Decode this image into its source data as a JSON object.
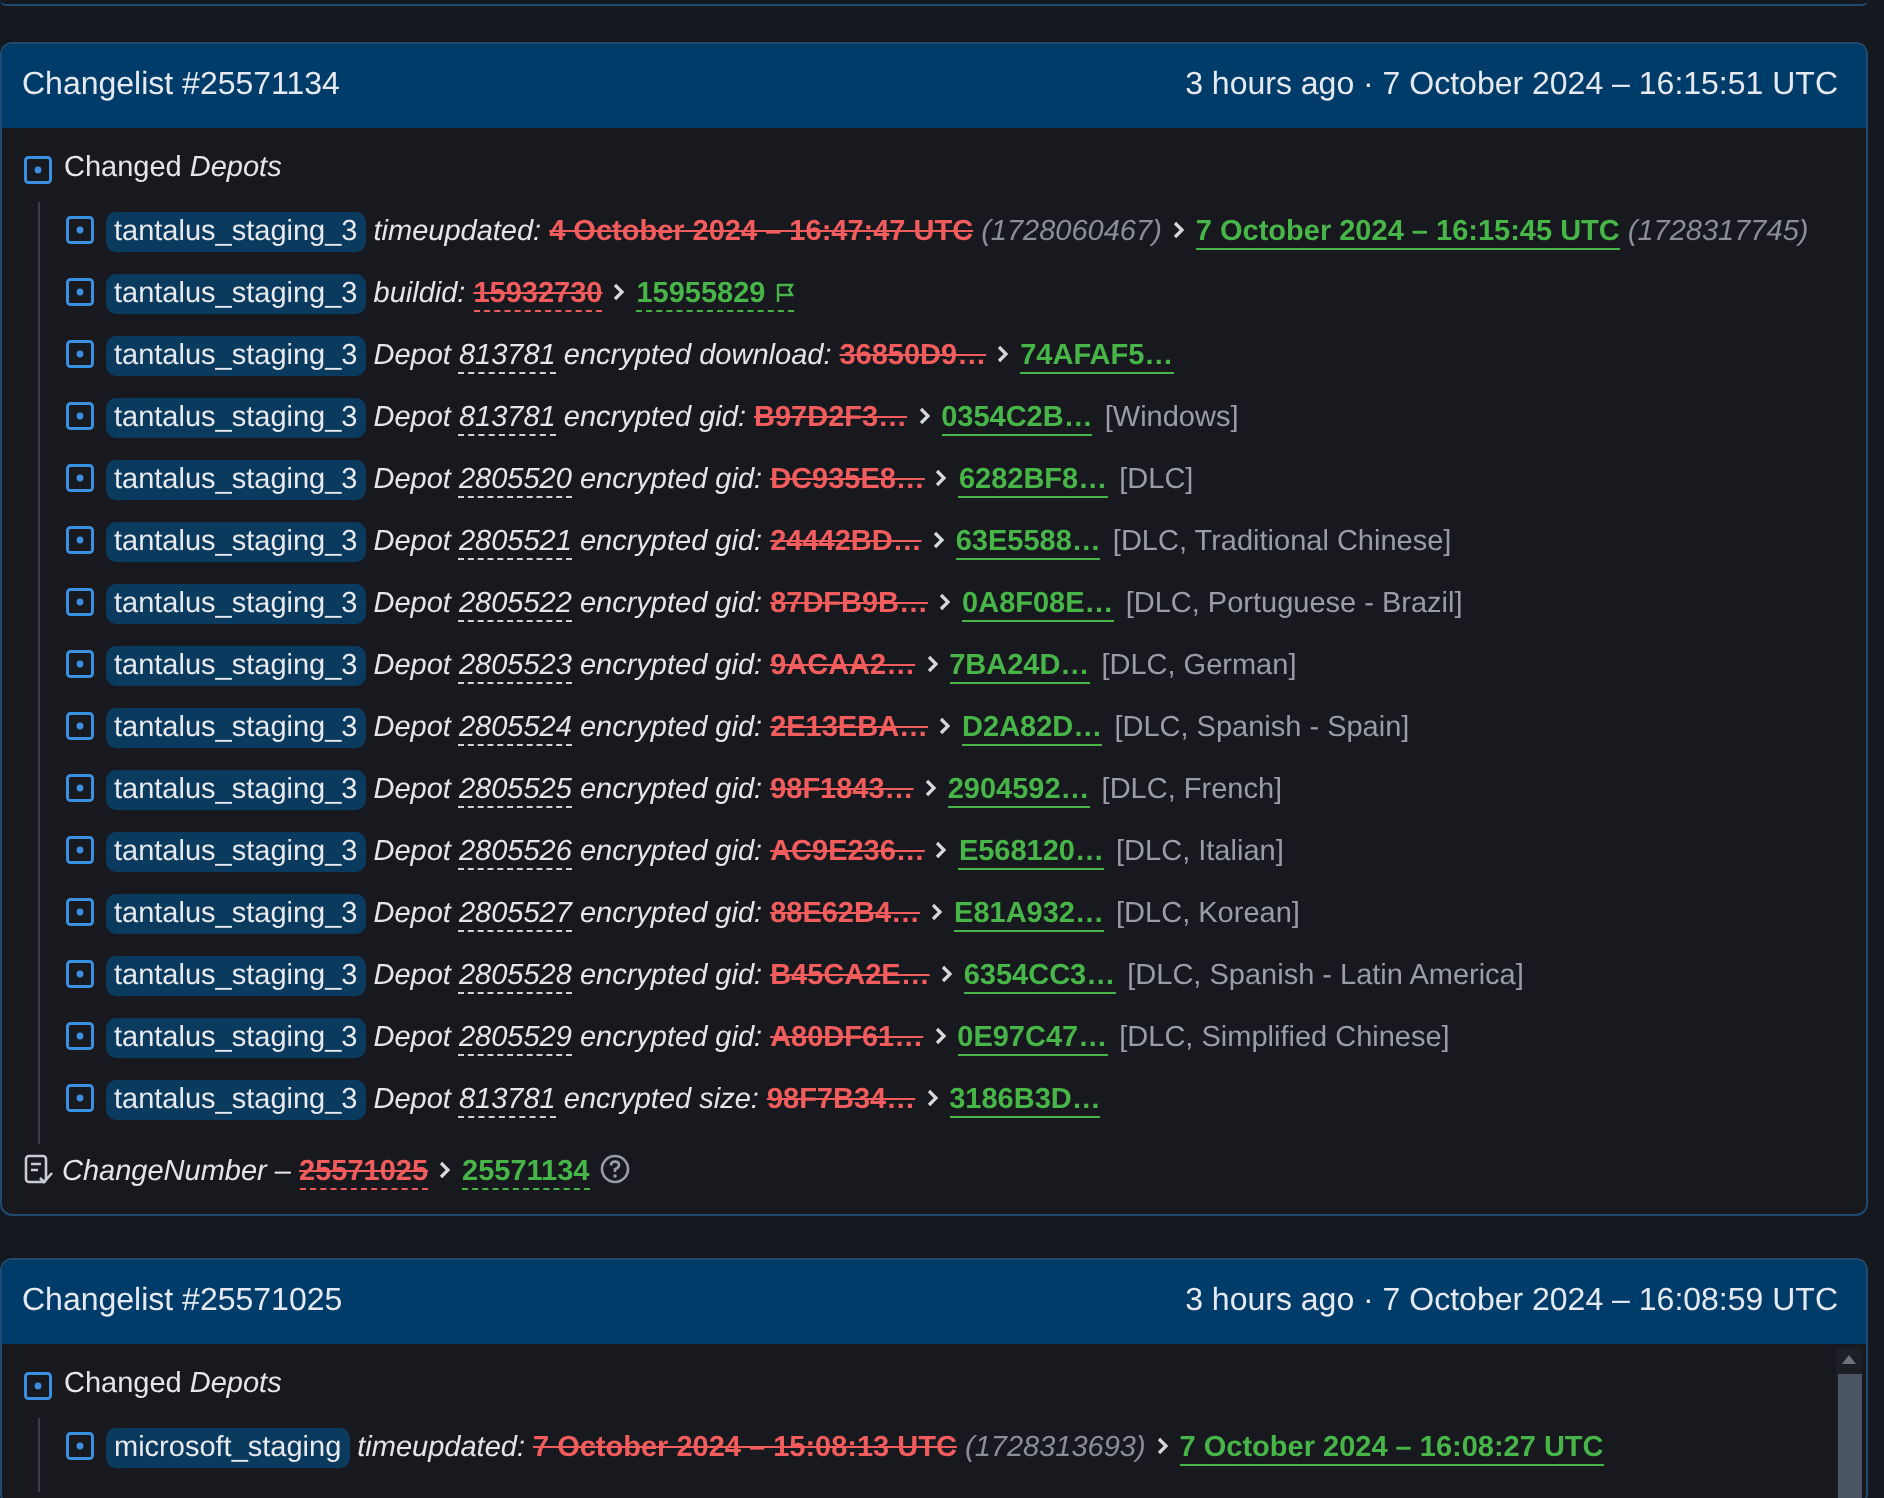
{
  "changelists": [
    {
      "title": "Changelist #25571134",
      "time": "3 hours ago · 7 October 2024 – 16:15:51 UTC",
      "section": "Changed *Depots*",
      "items": [
        {
          "kind": "time",
          "app": "tantalus_staging_3",
          "key": "timeupdated:",
          "old": "4 October 2024 – 16:47:47 UTC",
          "old_raw": "(1728060467)",
          "new": "7 October 2024 – 16:15:45 UTC",
          "new_raw": "(1728317745)"
        },
        {
          "kind": "number",
          "app": "tantalus_staging_3",
          "key": "buildid:",
          "old": "15932730",
          "new": "15955829"
        },
        {
          "kind": "hash",
          "app": "tantalus_staging_3",
          "prefix": "Depot",
          "depot": "813781",
          "key": "encrypted download:",
          "old": "36850D9…",
          "new": "74AFAF5…"
        },
        {
          "kind": "hash",
          "app": "tantalus_staging_3",
          "prefix": "Depot",
          "depot": "813781",
          "key": "encrypted gid:",
          "old": "B97D2F3…",
          "new": "0354C2B…",
          "tag": "[Windows]"
        },
        {
          "kind": "hash",
          "app": "tantalus_staging_3",
          "prefix": "Depot",
          "depot": "2805520",
          "key": "encrypted gid:",
          "old": "DC935E8…",
          "new": "6282BF8…",
          "tag": "[DLC]"
        },
        {
          "kind": "hash",
          "app": "tantalus_staging_3",
          "prefix": "Depot",
          "depot": "2805521",
          "key": "encrypted gid:",
          "old": "24442BD…",
          "new": "63E5588…",
          "tag": "[DLC, Traditional Chinese]"
        },
        {
          "kind": "hash",
          "app": "tantalus_staging_3",
          "prefix": "Depot",
          "depot": "2805522",
          "key": "encrypted gid:",
          "old": "87DFB9B…",
          "new": "0A8F08E…",
          "tag": "[DLC, Portuguese - Brazil]"
        },
        {
          "kind": "hash",
          "app": "tantalus_staging_3",
          "prefix": "Depot",
          "depot": "2805523",
          "key": "encrypted gid:",
          "old": "9ACAA2…",
          "new": "7BA24D…",
          "tag": "[DLC, German]"
        },
        {
          "kind": "hash",
          "app": "tantalus_staging_3",
          "prefix": "Depot",
          "depot": "2805524",
          "key": "encrypted gid:",
          "old": "2E13EBA…",
          "new": "D2A82D…",
          "tag": "[DLC, Spanish - Spain]"
        },
        {
          "kind": "hash",
          "app": "tantalus_staging_3",
          "prefix": "Depot",
          "depot": "2805525",
          "key": "encrypted gid:",
          "old": "98F1843…",
          "new": "2904592…",
          "tag": "[DLC, French]"
        },
        {
          "kind": "hash",
          "app": "tantalus_staging_3",
          "prefix": "Depot",
          "depot": "2805526",
          "key": "encrypted gid:",
          "old": "AC9E236…",
          "new": "E568120…",
          "tag": "[DLC, Italian]"
        },
        {
          "kind": "hash",
          "app": "tantalus_staging_3",
          "prefix": "Depot",
          "depot": "2805527",
          "key": "encrypted gid:",
          "old": "88E62B4…",
          "new": "E81A932…",
          "tag": "[DLC, Korean]"
        },
        {
          "kind": "hash",
          "app": "tantalus_staging_3",
          "prefix": "Depot",
          "depot": "2805528",
          "key": "encrypted gid:",
          "old": "B45CA2E…",
          "new": "6354CC3…",
          "tag": "[DLC, Spanish - Latin America]"
        },
        {
          "kind": "hash",
          "app": "tantalus_staging_3",
          "prefix": "Depot",
          "depot": "2805529",
          "key": "encrypted gid:",
          "old": "A80DF61…",
          "new": "0E97C47…",
          "tag": "[DLC, Simplified Chinese]"
        },
        {
          "kind": "hash",
          "app": "tantalus_staging_3",
          "prefix": "Depot",
          "depot": "813781",
          "key": "encrypted size:",
          "old": "98F7B34…",
          "new": "3186B3D…"
        }
      ],
      "change_number": {
        "key": "ChangeNumber",
        "dash": "–",
        "old": "25571025",
        "new": "25571134"
      }
    },
    {
      "title": "Changelist #25571025",
      "time": "3 hours ago · 7 October 2024 – 16:08:59 UTC",
      "section": "Changed *Depots*",
      "items": [
        {
          "kind": "time",
          "app": "microsoft_staging",
          "key": "timeupdated:",
          "old": "7 October 2024 – 15:08:13 UTC",
          "old_raw": "(1728313693)",
          "new": "7 October 2024 – 16:08:27 UTC"
        }
      ]
    }
  ]
}
